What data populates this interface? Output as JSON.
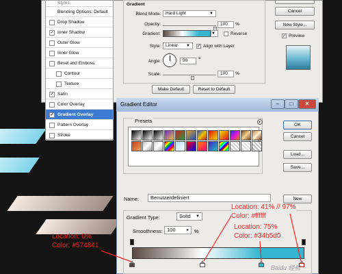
{
  "layer_style": {
    "header_partial": "Styles",
    "items": [
      {
        "label": "Blending Options: Default",
        "checkbox": false,
        "checked": false
      },
      {
        "label": "Drop Shadow",
        "checkbox": true,
        "checked": false
      },
      {
        "label": "Inner Shadow",
        "checkbox": true,
        "checked": true
      },
      {
        "label": "Outer Glow",
        "checkbox": true,
        "checked": false
      },
      {
        "label": "Inner Glow",
        "checkbox": true,
        "checked": false
      },
      {
        "label": "Bevel and Emboss",
        "checkbox": true,
        "checked": false
      },
      {
        "label": "Contour",
        "checkbox": true,
        "checked": false,
        "sub": true
      },
      {
        "label": "Texture",
        "checkbox": true,
        "checked": false,
        "sub": true
      },
      {
        "label": "Satin",
        "checkbox": true,
        "checked": true
      },
      {
        "label": "Color Overlay",
        "checkbox": true,
        "checked": false
      },
      {
        "label": "Gradient Overlay",
        "checkbox": true,
        "checked": true,
        "selected": true
      },
      {
        "label": "Pattern Overlay",
        "checkbox": true,
        "checked": false
      },
      {
        "label": "Stroke",
        "checkbox": true,
        "checked": false
      }
    ],
    "gradient_group": "Gradient",
    "blend_mode_label": "Blend Mode:",
    "blend_mode": "Hard Light",
    "opacity_label": "Opacity:",
    "opacity": "100",
    "percent": "%",
    "gradient_label": "Gradient:",
    "reverse_label": "Reverse",
    "style_label": "Style:",
    "style": "Linear",
    "align_label": "Align with Layer",
    "angle_label": "Angle:",
    "angle": "90",
    "degree": "°",
    "scale_label": "Scale:",
    "scale": "100",
    "make_default": "Make Default",
    "reset_default": "Reset to Default",
    "cancel": "Cancel",
    "new_style": "New Style...",
    "preview_label": "Preview"
  },
  "gradient_editor": {
    "title": "Gradient Editor",
    "presets_label": "Presets",
    "ok": "OK",
    "cancel": "Cancel",
    "load": "Load...",
    "save": "Save...",
    "name_label": "Name:",
    "name_value": "Benutzerdefiniert",
    "new_button": "New",
    "gradient_type_label": "Gradient Type:",
    "gradient_type": "Solid",
    "smoothness_label": "Smoothness:",
    "smoothness": "100",
    "percent": "%"
  },
  "annotations": {
    "a1_line1": "Location: 0%",
    "a1_line2": "Color: #574841",
    "a2_line1": "Location: 41% // 97%",
    "a2_line2": "Color: #ffffff",
    "a3_line1": "Location: 75%",
    "a3_line2": "Color: #34b5d0",
    "watermark": "Baidu 经验"
  },
  "colors": {
    "stop_0": "#574841",
    "stop_41": "#ffffff",
    "stop_75": "#34b5d0",
    "annotation": "#ff2020",
    "selection": "#3d7bd1"
  }
}
